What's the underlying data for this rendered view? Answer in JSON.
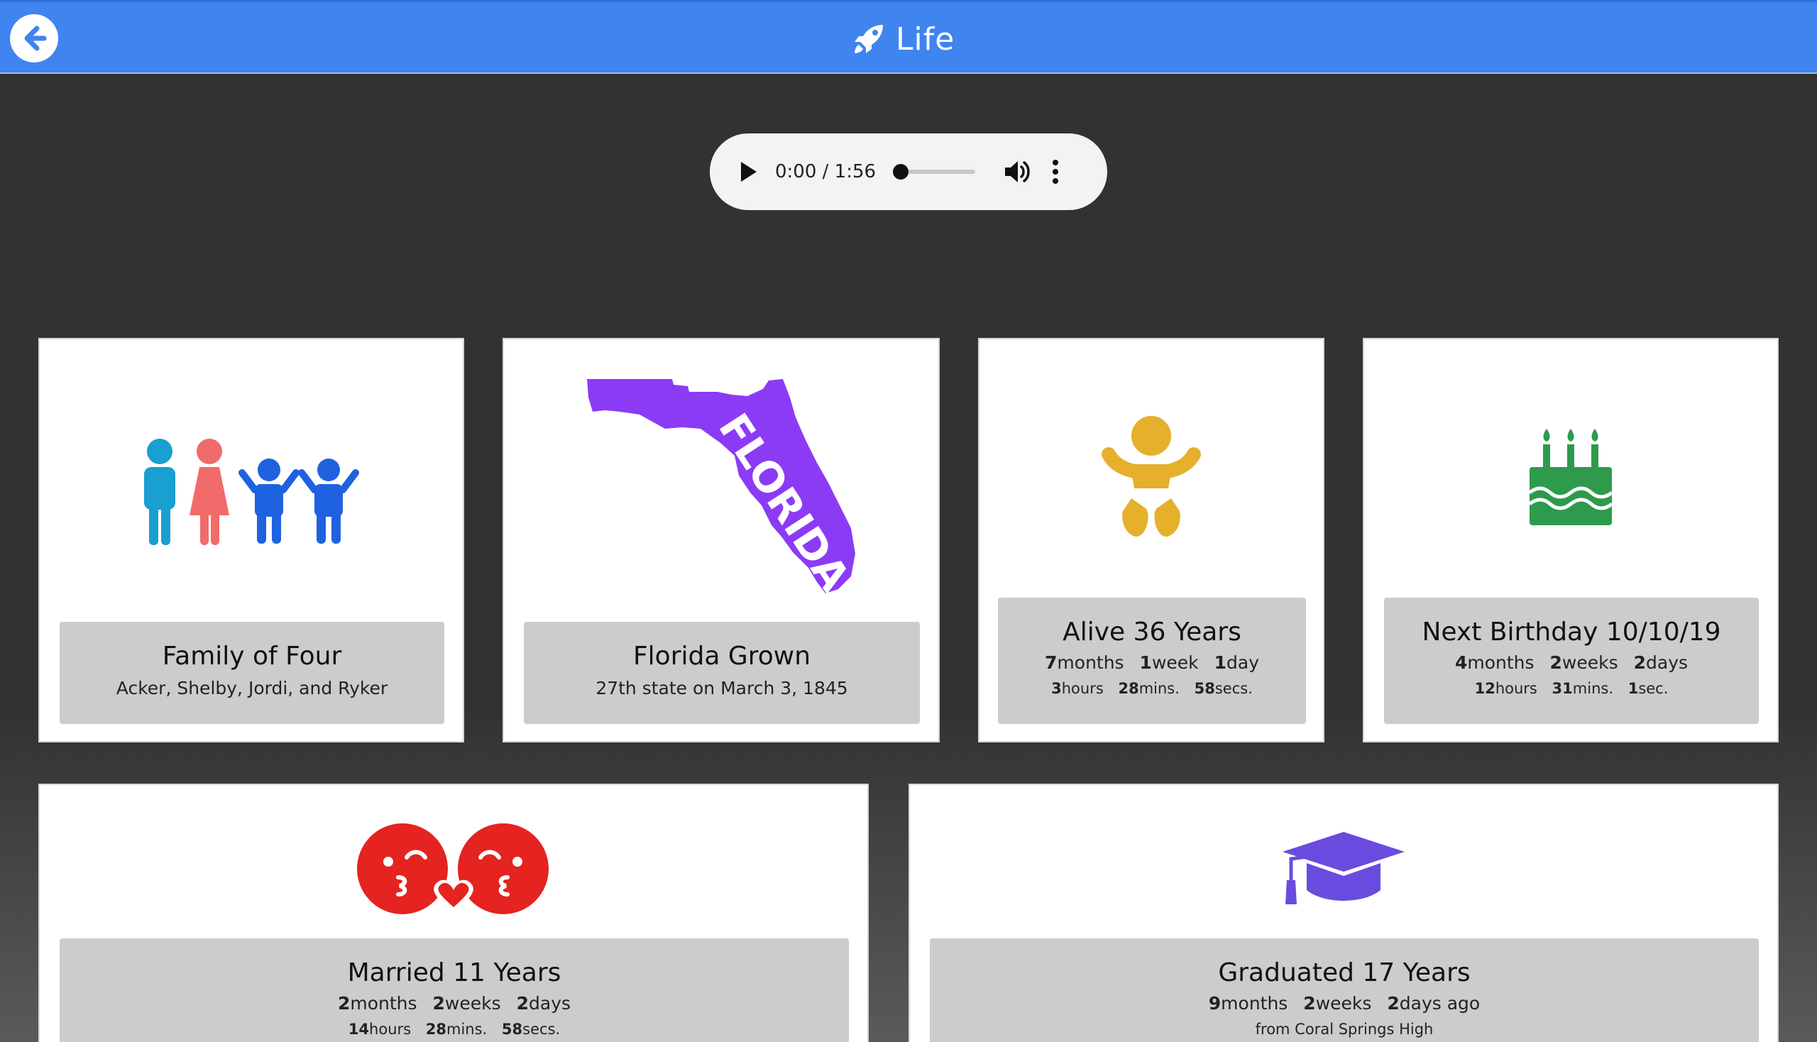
{
  "header": {
    "title": "Life",
    "back_icon": "arrow-left-icon",
    "title_icon": "rocket-icon",
    "bg_color": "#3f84ef"
  },
  "player": {
    "time": "0:00 / 1:56",
    "progress": 0
  },
  "cards": {
    "family": {
      "icon": "family-icon",
      "title": "Family of Four",
      "subtitle": "Acker, Shelby, Jordi, and Ryker"
    },
    "florida": {
      "icon": "florida-map-icon",
      "map_label": "FLORIDA",
      "title": "Florida Grown",
      "subtitle": "27th state on March 3, 1845"
    },
    "alive": {
      "icon": "baby-icon",
      "title": "Alive 36 Years",
      "line1": {
        "a_num": "7",
        "a_unit": "months",
        "b_num": "1",
        "b_unit": "week",
        "c_num": "1",
        "c_unit": "day"
      },
      "line2": {
        "a_num": "3",
        "a_unit": "hours",
        "b_num": "28",
        "b_unit": "mins.",
        "c_num": "58",
        "c_unit": "secs."
      }
    },
    "birthday": {
      "icon": "birthday-cake-icon",
      "title": "Next Birthday 10/10/19",
      "line1": {
        "a_num": "4",
        "a_unit": "months",
        "b_num": "2",
        "b_unit": "weeks",
        "c_num": "2",
        "c_unit": "days"
      },
      "line2": {
        "a_num": "12",
        "a_unit": "hours",
        "b_num": "31",
        "b_unit": "mins.",
        "c_num": "1",
        "c_unit": "sec."
      }
    },
    "married": {
      "icon": "kissing-faces-icon",
      "title": "Married 11 Years",
      "line1": {
        "a_num": "2",
        "a_unit": "months",
        "b_num": "2",
        "b_unit": "weeks",
        "c_num": "2",
        "c_unit": "days"
      },
      "line2": {
        "a_num": "14",
        "a_unit": "hours",
        "b_num": "28",
        "b_unit": "mins.",
        "c_num": "58",
        "c_unit": "secs."
      }
    },
    "graduated": {
      "icon": "graduation-cap-icon",
      "title": "Graduated 17 Years",
      "line1": {
        "a_num": "9",
        "a_unit": "months",
        "b_num": "2",
        "b_unit": "weeks",
        "c_num": "2",
        "c_unit": "days ago"
      },
      "line2_text": "from Coral Springs High"
    }
  },
  "colors": {
    "family_man": "#1a9fd1",
    "family_woman": "#f26b6b",
    "family_kids": "#1f62e0",
    "florida": "#8c3bf5",
    "baby": "#e6b02d",
    "cake": "#2e9a4c",
    "kiss": "#e52320",
    "cap": "#6a4be0"
  }
}
